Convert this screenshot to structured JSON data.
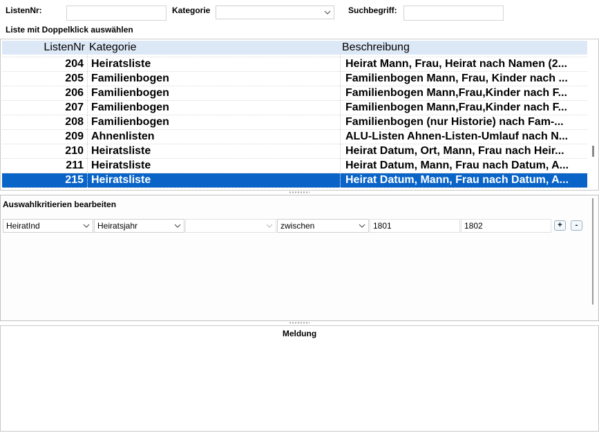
{
  "filter": {
    "listnr_label": "ListenNr:",
    "listnr_value": "",
    "kategorie_label": "Kategorie",
    "kategorie_value": "",
    "suchbegriff_label": "Suchbegriff:",
    "suchbegriff_value": ""
  },
  "hint": "Liste mit Doppelklick auswählen",
  "table": {
    "columns": [
      "ListenNr",
      "Kategorie",
      "Beschreibung"
    ],
    "rows": [
      {
        "nr": "204",
        "kat": "Heiratsliste",
        "bes": "Heirat Mann, Frau, Heirat nach Namen (2..."
      },
      {
        "nr": "205",
        "kat": "Familienbogen",
        "bes": "Familienbogen Mann, Frau, Kinder nach ..."
      },
      {
        "nr": "206",
        "kat": "Familienbogen",
        "bes": "Familienbogen Mann,Frau,Kinder nach F..."
      },
      {
        "nr": "207",
        "kat": "Familienbogen",
        "bes": "Familienbogen Mann,Frau,Kinder nach F..."
      },
      {
        "nr": "208",
        "kat": "Familienbogen",
        "bes": "Familienbogen (nur Historie) nach Fam-..."
      },
      {
        "nr": "209",
        "kat": "Ahnenlisten",
        "bes": "ALU-Listen Ahnen-Listen-Umlauf nach N..."
      },
      {
        "nr": "210",
        "kat": "Heiratsliste",
        "bes": "Heirat Datum, Ort, Mann, Frau nach Heir..."
      },
      {
        "nr": "211",
        "kat": "Heiratsliste",
        "bes": "Heirat Datum, Mann, Frau nach Datum, A..."
      },
      {
        "nr": "215",
        "kat": "Heiratsliste",
        "bes": "Heirat Datum, Mann, Frau nach Datum, A..."
      }
    ],
    "selected_index": 8,
    "selected_color": "#0a64c8"
  },
  "criteria": {
    "title": "Auswahlkritierien bearbeiten",
    "field": "HeiratInd",
    "attribute": "Heiratsjahr",
    "modifier": "",
    "operator": "zwischen",
    "value_from": "1801",
    "value_to": "1802",
    "add_label": "+",
    "remove_label": "-"
  },
  "message": {
    "title": "Meldung"
  }
}
